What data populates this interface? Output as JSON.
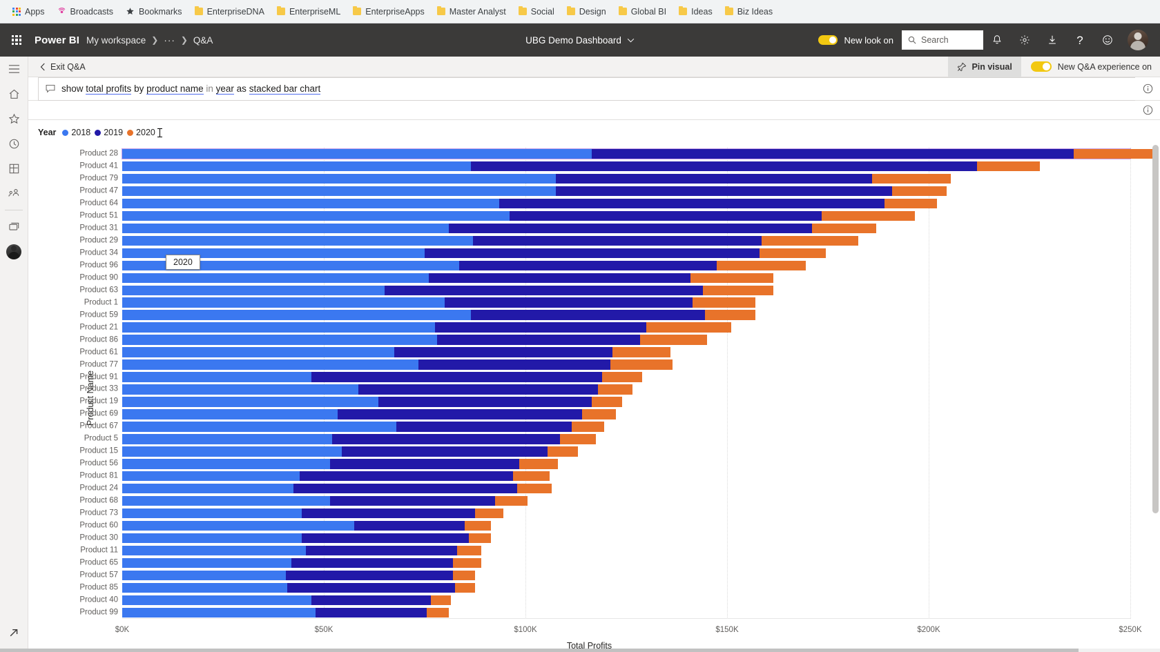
{
  "browser": {
    "bookmarks": [
      {
        "label": "Apps",
        "icon": "apps-grid-icon"
      },
      {
        "label": "Broadcasts",
        "icon": "broadcast-icon"
      },
      {
        "label": "Bookmarks",
        "icon": "star-icon"
      },
      {
        "label": "EnterpriseDNA",
        "icon": "folder-icon"
      },
      {
        "label": "EnterpriseML",
        "icon": "folder-icon"
      },
      {
        "label": "EnterpriseApps",
        "icon": "folder-icon"
      },
      {
        "label": "Master Analyst",
        "icon": "folder-icon"
      },
      {
        "label": "Social",
        "icon": "folder-icon"
      },
      {
        "label": "Design",
        "icon": "folder-icon"
      },
      {
        "label": "Global BI",
        "icon": "folder-icon"
      },
      {
        "label": "Ideas",
        "icon": "folder-icon"
      },
      {
        "label": "Biz Ideas",
        "icon": "folder-icon"
      }
    ]
  },
  "header": {
    "waffle_icon": "waffle-grid-icon",
    "brand": "Power BI",
    "breadcrumb": {
      "workspace": "My workspace",
      "overflow": "···",
      "current": "Q&A",
      "separator": "›"
    },
    "report_title": "UBG Demo Dashboard",
    "report_title_caret": "∨",
    "new_look_label": "New look on",
    "new_look_on": true,
    "search_placeholder": "Search",
    "icons": [
      {
        "name": "notifications-icon",
        "glyph": "bell"
      },
      {
        "name": "settings-icon",
        "glyph": "gear"
      },
      {
        "name": "downloads-icon",
        "glyph": "download"
      },
      {
        "name": "help-icon",
        "glyph": "question"
      },
      {
        "name": "feedback-icon",
        "glyph": "smiley"
      }
    ],
    "accent_yellow": "#f2c811",
    "background": "#3b3a39"
  },
  "rail": {
    "items": [
      {
        "name": "nav-menu-icon",
        "label": "Navigation"
      },
      {
        "name": "home-icon",
        "label": "Home"
      },
      {
        "name": "favorites-star-icon",
        "label": "Favorites"
      },
      {
        "name": "recent-clock-icon",
        "label": "Recent"
      },
      {
        "name": "apps-icon",
        "label": "Apps"
      },
      {
        "name": "shared-with-me-icon",
        "label": "Shared with me"
      },
      {
        "name": "workspaces-icon",
        "label": "Workspaces"
      },
      {
        "name": "my-workspace-avatar",
        "label": "My workspace"
      }
    ],
    "bottom": {
      "name": "expand-arrow-icon",
      "label": "Expand"
    }
  },
  "qa_toolbar": {
    "exit_label": "Exit Q&A",
    "back_caret": "‹",
    "pin_visual_label": "Pin visual",
    "pin_icon": "pin-icon",
    "new_qa_label": "New Q&A experience on",
    "new_qa_on": true
  },
  "question": {
    "icon": "question-bubble-icon",
    "tokens": [
      {
        "text": "show ",
        "underline": false,
        "dim": false
      },
      {
        "text": "total profits",
        "underline": true,
        "dim": false
      },
      {
        "text": " by ",
        "underline": false,
        "dim": false
      },
      {
        "text": "product name",
        "underline": true,
        "dim": false
      },
      {
        "text": " in ",
        "underline": false,
        "dim": true
      },
      {
        "text": "year",
        "underline": true,
        "dim": false
      },
      {
        "text": " as ",
        "underline": false,
        "dim": false
      },
      {
        "text": "stacked bar chart",
        "underline": true,
        "dim": false
      }
    ],
    "full_text": "show total profits by product name in year as stacked bar chart",
    "info_icon": "info-circle-icon",
    "info_icon_2": "info-circle-icon"
  },
  "tooltip": {
    "text": "2020"
  },
  "chart_data": {
    "type": "bar",
    "orientation": "horizontal",
    "stacked": true,
    "title": "",
    "xlabel": "Total Profits",
    "ylabel": "Product Name",
    "legend_title": "Year",
    "legend_position": "top-left",
    "grid": true,
    "xlim": [
      0,
      250000
    ],
    "xticks": [
      0,
      50000,
      100000,
      150000,
      200000,
      250000
    ],
    "xtick_labels": [
      "$0K",
      "$50K",
      "$100K",
      "$150K",
      "$200K",
      "$250K"
    ],
    "series": [
      {
        "name": "2018",
        "color": "#3b78f0"
      },
      {
        "name": "2019",
        "color": "#2219a8"
      },
      {
        "name": "2020",
        "color": "#e8732a"
      }
    ],
    "categories": [
      "Product 28",
      "Product 41",
      "Product 79",
      "Product 47",
      "Product 64",
      "Product 51",
      "Product 31",
      "Product 29",
      "Product 34",
      "Product 96",
      "Product 90",
      "Product 63",
      "Product 1",
      "Product 59",
      "Product 21",
      "Product 86",
      "Product 61",
      "Product 77",
      "Product 91",
      "Product 33",
      "Product 19",
      "Product 69",
      "Product 67",
      "Product 5",
      "Product 15",
      "Product 56",
      "Product 81",
      "Product 24",
      "Product 68",
      "Product 73",
      "Product 60",
      "Product 30",
      "Product 11",
      "Product 65",
      "Product 57",
      "Product 85",
      "Product 40",
      "Product 99"
    ],
    "values": {
      "2018": [
        116500,
        86500,
        107500,
        107500,
        93500,
        96000,
        81000,
        87000,
        75000,
        83500,
        76000,
        65000,
        80000,
        86500,
        77500,
        78000,
        67500,
        73500,
        47000,
        58500,
        63500,
        53500,
        68000,
        52000,
        54500,
        51500,
        44000,
        42500,
        51500,
        44500,
        57500,
        44500,
        45500,
        42000,
        40500,
        41000,
        47000,
        48000
      ],
      "2019": [
        119500,
        125500,
        78500,
        83500,
        95500,
        77500,
        90000,
        71500,
        83000,
        64000,
        65000,
        79000,
        61500,
        58000,
        52500,
        50500,
        54000,
        47500,
        72000,
        59500,
        53000,
        60500,
        43500,
        56500,
        51000,
        47000,
        53000,
        55500,
        41000,
        43000,
        27500,
        41500,
        37500,
        40000,
        41500,
        41500,
        29500,
        27500
      ],
      "2020": [
        21000,
        15500,
        19500,
        13500,
        13000,
        23000,
        16000,
        24000,
        16500,
        22000,
        20500,
        17500,
        15500,
        12500,
        21000,
        16500,
        14500,
        15500,
        10000,
        8500,
        7500,
        8500,
        8000,
        9000,
        7500,
        9500,
        9000,
        8500,
        8000,
        7000,
        6500,
        5500,
        6000,
        7000,
        5500,
        5000,
        5000,
        5500
      ]
    },
    "highlighted_category": "Product 28"
  },
  "scroll": {
    "vertical_thumb_name": "chart-vertical-scrollbar",
    "horizontal_thumb_name": "window-horizontal-scrollbar"
  }
}
